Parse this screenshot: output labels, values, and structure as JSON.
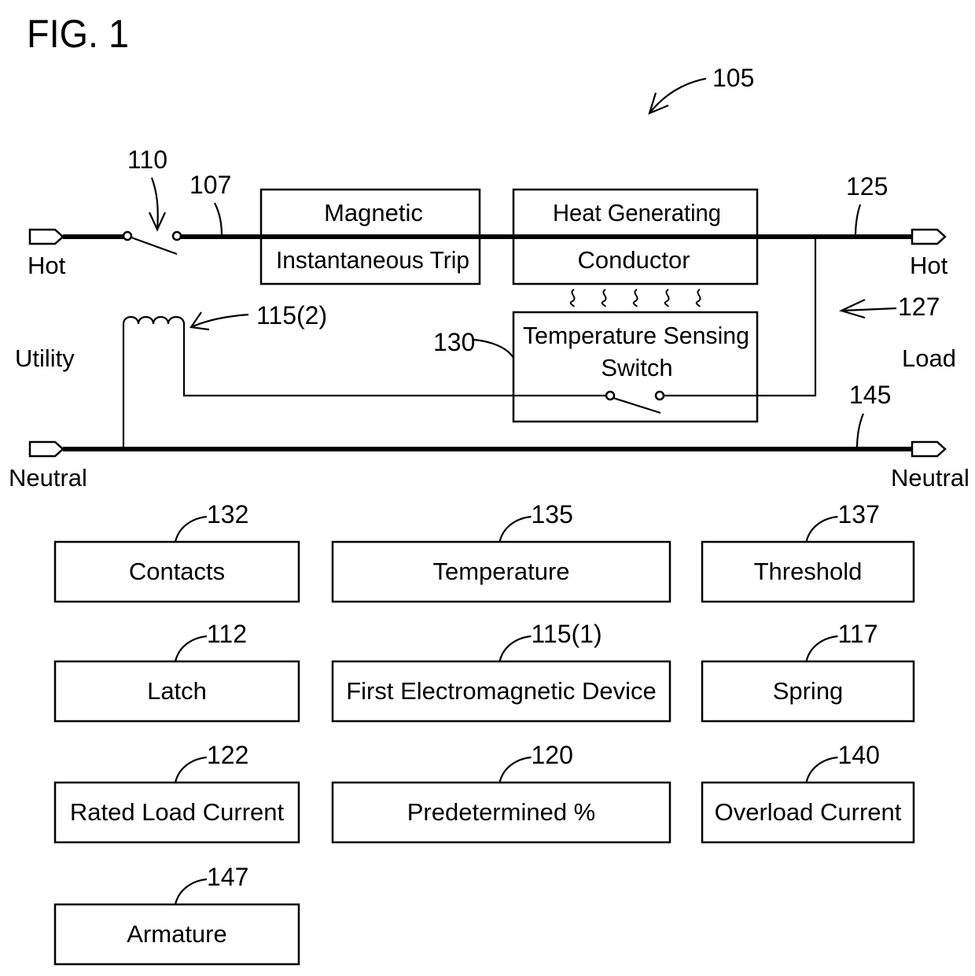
{
  "figure": {
    "title": "FIG. 1",
    "ref_system": "105"
  },
  "circuit": {
    "utility_label": "Utility",
    "load_label": "Load",
    "load_ref": "127",
    "hot_left": "Hot",
    "hot_right": "Hot",
    "neutral_left": "Neutral",
    "neutral_right": "Neutral",
    "contacts_ref": "110",
    "hot_line_ref": "107",
    "hot_load_ref": "125",
    "neutral_ref": "145",
    "coil_ref": "115(2)",
    "temp_switch_ref": "130",
    "magnetic_trip": {
      "line1": "Magnetic",
      "line2": "Instantaneous Trip"
    },
    "heat_conductor": {
      "line1": "Heat Generating",
      "line2": "Conductor"
    },
    "temp_switch": {
      "line1": "Temperature Sensing",
      "line2": "Switch"
    }
  },
  "legend_boxes": [
    {
      "ref": "132",
      "label": "Contacts"
    },
    {
      "ref": "135",
      "label": "Temperature"
    },
    {
      "ref": "137",
      "label": "Threshold"
    },
    {
      "ref": "112",
      "label": "Latch"
    },
    {
      "ref": "115(1)",
      "label": "First Electromagnetic Device"
    },
    {
      "ref": "117",
      "label": "Spring"
    },
    {
      "ref": "122",
      "label": "Rated Load Current"
    },
    {
      "ref": "120",
      "label": "Predetermined %"
    },
    {
      "ref": "140",
      "label": "Overload Current"
    },
    {
      "ref": "147",
      "label": "Armature"
    }
  ]
}
